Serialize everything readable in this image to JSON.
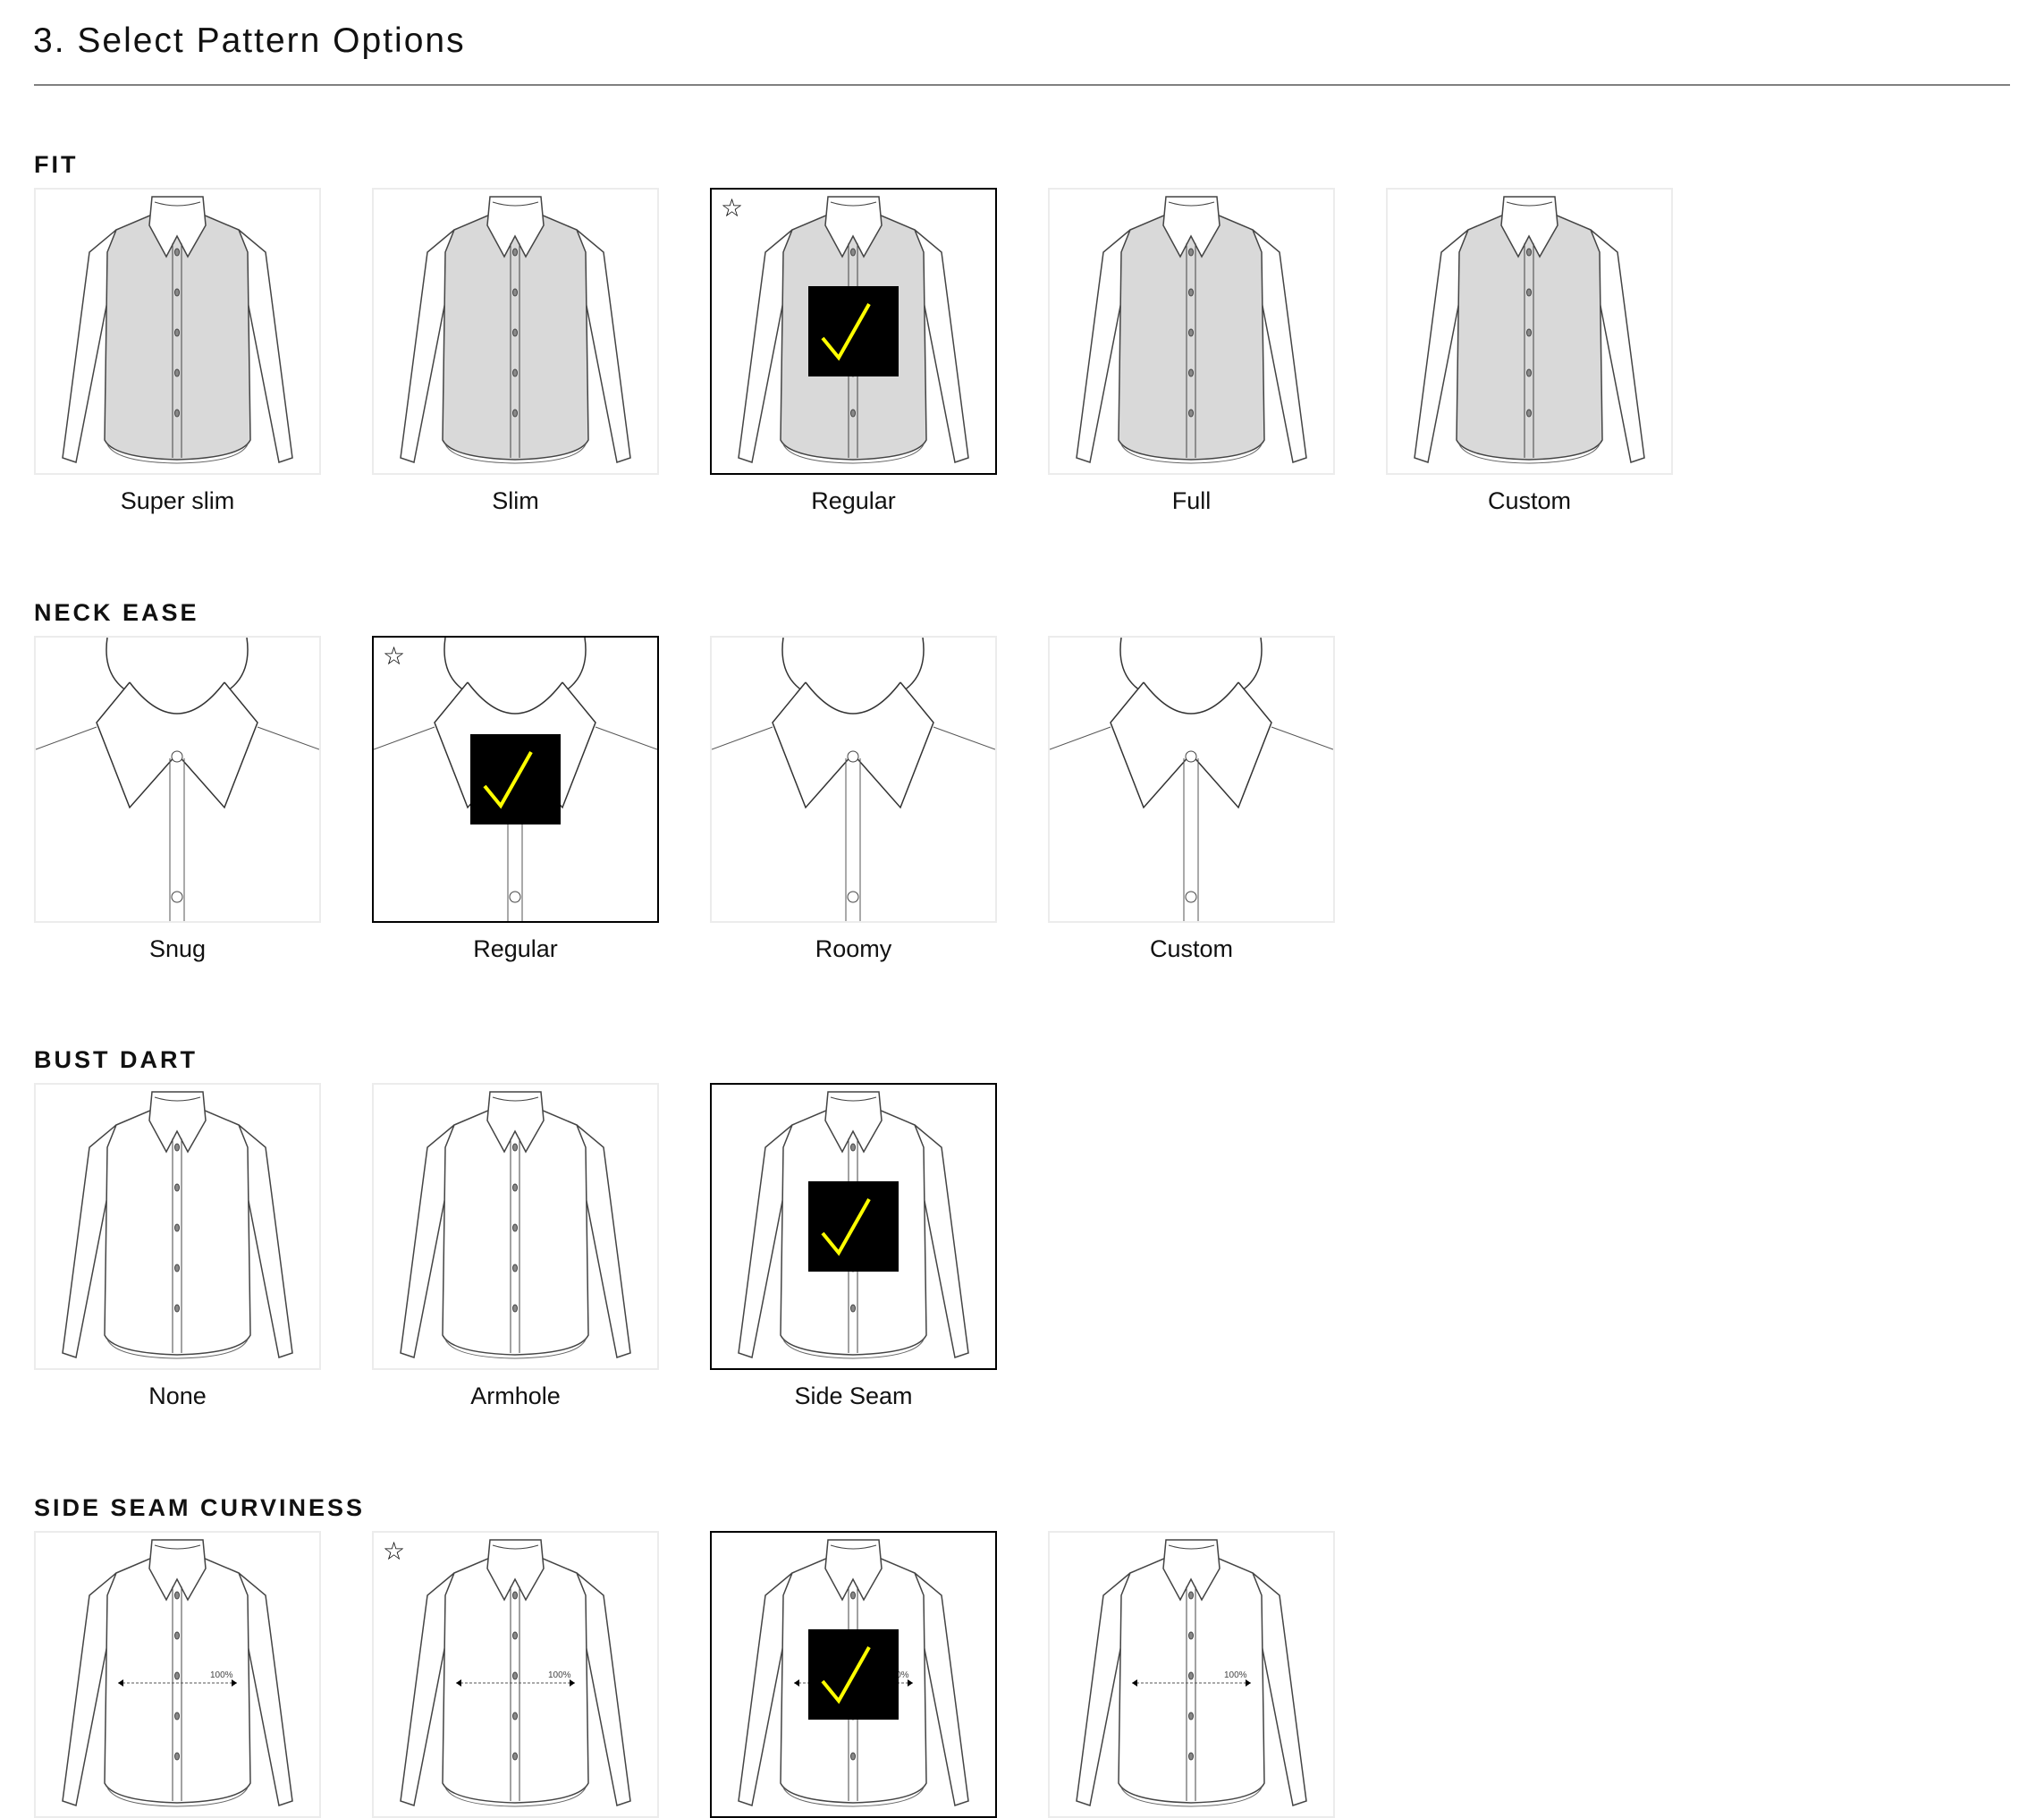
{
  "page": {
    "title": "3. Select Pattern Options"
  },
  "colors": {
    "selected_border": "#000000",
    "check_bg": "#000000",
    "check_mark": "#ffff00",
    "tile_border": "#ececec",
    "body_fill": "#d9d9d9"
  },
  "sections": [
    {
      "label": "FIT",
      "illustration": "shirt-shaded",
      "options": [
        {
          "label": "Super slim",
          "selected": false,
          "recommended": false
        },
        {
          "label": "Slim",
          "selected": false,
          "recommended": false
        },
        {
          "label": "Regular",
          "selected": true,
          "recommended": true
        },
        {
          "label": "Full",
          "selected": false,
          "recommended": false
        },
        {
          "label": "Custom",
          "selected": false,
          "recommended": false
        }
      ]
    },
    {
      "label": "NECK EASE",
      "illustration": "neck",
      "options": [
        {
          "label": "Snug",
          "selected": false,
          "recommended": false
        },
        {
          "label": "Regular",
          "selected": true,
          "recommended": true
        },
        {
          "label": "Roomy",
          "selected": false,
          "recommended": false
        },
        {
          "label": "Custom",
          "selected": false,
          "recommended": false
        }
      ]
    },
    {
      "label": "BUST DART",
      "illustration": "shirt-plain",
      "options": [
        {
          "label": "None",
          "selected": false,
          "recommended": false
        },
        {
          "label": "Armhole",
          "selected": false,
          "recommended": false
        },
        {
          "label": "Side Seam",
          "selected": true,
          "recommended": false
        }
      ]
    },
    {
      "label": "SIDE SEAM CURVINESS",
      "illustration": "shirt-measure",
      "measure_label": "100%",
      "options": [
        {
          "selected": false,
          "recommended": false
        },
        {
          "selected": false,
          "recommended": true
        },
        {
          "selected": true,
          "recommended": false
        },
        {
          "selected": false,
          "recommended": false
        }
      ]
    }
  ],
  "icons": {
    "recommended": "star-outline-icon",
    "selected": "checkmark-icon"
  }
}
